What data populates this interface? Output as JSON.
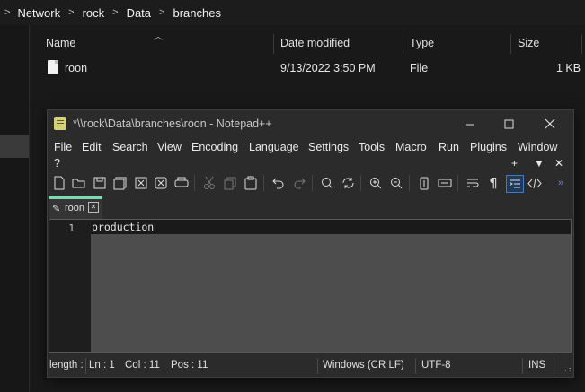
{
  "explorer": {
    "breadcrumb": [
      "Network",
      "rock",
      "Data",
      "branches"
    ],
    "columns": {
      "name": "Name",
      "date": "Date modified",
      "type": "Type",
      "size": "Size"
    },
    "files": [
      {
        "name": "roon",
        "date": "9/13/2022 3:50 PM",
        "type": "File",
        "size": "1 KB"
      }
    ]
  },
  "notepad": {
    "title": "*\\\\rock\\Data\\branches\\roon - Notepad++",
    "menu": [
      "File",
      "Edit",
      "Search",
      "View",
      "Encoding",
      "Language",
      "Settings",
      "Tools",
      "Macro",
      "Run",
      "Plugins",
      "Window",
      "?"
    ],
    "menu_controls": [
      "+",
      "▼",
      "✕"
    ],
    "tab": {
      "label": "roon"
    },
    "editor": {
      "line_number": "1",
      "text": "production"
    },
    "status": {
      "length": "length :",
      "ln": "Ln : 1",
      "col": "Col : 11",
      "pos": "Pos : 11",
      "eol": "Windows (CR LF)",
      "encoding": "UTF-8",
      "mode": "INS"
    }
  },
  "colors": {
    "accent_tab": "#7fd8b0",
    "background": "#191919"
  }
}
